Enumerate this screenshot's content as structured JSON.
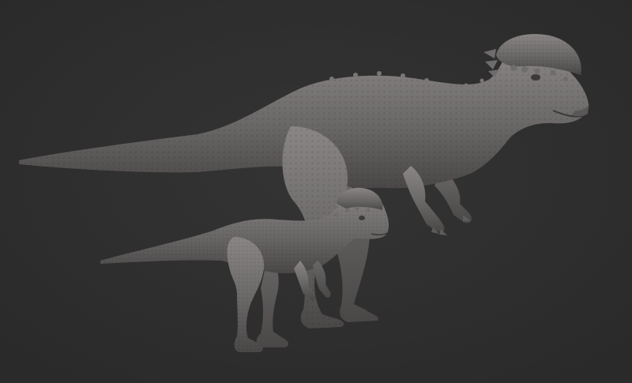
{
  "scene": {
    "background_color": "#343434",
    "vignette_color": "#2a2a2a",
    "clay_base_color": "#6a6767",
    "clay_light_color": "#8a8686",
    "clay_shadow_color": "#4a4747",
    "subjects": [
      {
        "role": "adult",
        "description_icon": "pachycephalosaurus-adult-sculpt"
      },
      {
        "role": "juvenile",
        "description_icon": "pachycephalosaurus-juvenile-sculpt"
      }
    ]
  }
}
